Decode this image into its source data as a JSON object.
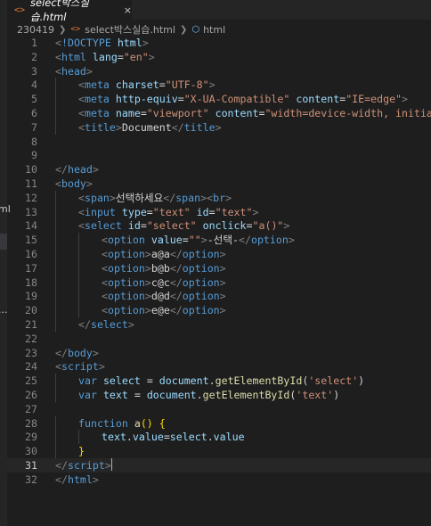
{
  "explorer": {
    "fragment_1": "ml",
    "fragment_2": "..."
  },
  "tab": {
    "icon": "html-file-icon",
    "label": "select박스실습.html",
    "close": "×"
  },
  "breadcrumb": {
    "folder": "230419",
    "file": "select박스실습.html",
    "symbol": "html"
  },
  "editor": {
    "current_line": 31,
    "lines": [
      {
        "n": "1",
        "indent": 0,
        "tokens": [
          [
            "br",
            "<"
          ],
          [
            "tag",
            "!DOCTYPE"
          ],
          [
            "txt",
            " "
          ],
          [
            "attr",
            "html"
          ],
          [
            "br",
            ">"
          ]
        ]
      },
      {
        "n": "2",
        "indent": 0,
        "tokens": [
          [
            "br",
            "<"
          ],
          [
            "tag",
            "html"
          ],
          [
            "txt",
            " "
          ],
          [
            "attr",
            "lang"
          ],
          [
            "pn",
            "="
          ],
          [
            "str",
            "\"en\""
          ],
          [
            "br",
            ">"
          ]
        ]
      },
      {
        "n": "3",
        "indent": 0,
        "tokens": [
          [
            "br",
            "<"
          ],
          [
            "tag",
            "head"
          ],
          [
            "br",
            ">"
          ]
        ]
      },
      {
        "n": "4",
        "indent": 1,
        "tokens": [
          [
            "br",
            "<"
          ],
          [
            "tag",
            "meta"
          ],
          [
            "txt",
            " "
          ],
          [
            "attr",
            "charset"
          ],
          [
            "pn",
            "="
          ],
          [
            "str",
            "\"UTF-8\""
          ],
          [
            "br",
            ">"
          ]
        ]
      },
      {
        "n": "5",
        "indent": 1,
        "tokens": [
          [
            "br",
            "<"
          ],
          [
            "tag",
            "meta"
          ],
          [
            "txt",
            " "
          ],
          [
            "attr",
            "http-equiv"
          ],
          [
            "pn",
            "="
          ],
          [
            "str",
            "\"X-UA-Compatible\""
          ],
          [
            "txt",
            " "
          ],
          [
            "attr",
            "content"
          ],
          [
            "pn",
            "="
          ],
          [
            "str",
            "\"IE=edge\""
          ],
          [
            "br",
            ">"
          ]
        ]
      },
      {
        "n": "6",
        "indent": 1,
        "tokens": [
          [
            "br",
            "<"
          ],
          [
            "tag",
            "meta"
          ],
          [
            "txt",
            " "
          ],
          [
            "attr",
            "name"
          ],
          [
            "pn",
            "="
          ],
          [
            "str",
            "\"viewport\""
          ],
          [
            "txt",
            " "
          ],
          [
            "attr",
            "content"
          ],
          [
            "pn",
            "="
          ],
          [
            "str",
            "\"width=device-width, initial-sca"
          ]
        ]
      },
      {
        "n": "7",
        "indent": 1,
        "tokens": [
          [
            "br",
            "<"
          ],
          [
            "tag",
            "title"
          ],
          [
            "br",
            ">"
          ],
          [
            "txt",
            "Document"
          ],
          [
            "br",
            "</"
          ],
          [
            "tag",
            "title"
          ],
          [
            "br",
            ">"
          ]
        ]
      },
      {
        "n": "8",
        "indent": 0,
        "tokens": []
      },
      {
        "n": "9",
        "indent": 0,
        "tokens": []
      },
      {
        "n": "10",
        "indent": 0,
        "tokens": [
          [
            "br",
            "</"
          ],
          [
            "tag",
            "head"
          ],
          [
            "br",
            ">"
          ]
        ]
      },
      {
        "n": "11",
        "indent": 0,
        "tokens": [
          [
            "br",
            "<"
          ],
          [
            "tag",
            "body"
          ],
          [
            "br",
            ">"
          ]
        ]
      },
      {
        "n": "12",
        "indent": 1,
        "tokens": [
          [
            "br",
            "<"
          ],
          [
            "tag",
            "span"
          ],
          [
            "br",
            ">"
          ],
          [
            "txt",
            "선택하세요"
          ],
          [
            "br",
            "</"
          ],
          [
            "tag",
            "span"
          ],
          [
            "br",
            "><"
          ],
          [
            "tag",
            "br"
          ],
          [
            "br",
            ">"
          ]
        ]
      },
      {
        "n": "13",
        "indent": 1,
        "tokens": [
          [
            "br",
            "<"
          ],
          [
            "tag",
            "input"
          ],
          [
            "txt",
            " "
          ],
          [
            "attr",
            "type"
          ],
          [
            "pn",
            "="
          ],
          [
            "str",
            "\"text\""
          ],
          [
            "txt",
            " "
          ],
          [
            "attr",
            "id"
          ],
          [
            "pn",
            "="
          ],
          [
            "str",
            "\"text\""
          ],
          [
            "br",
            ">"
          ]
        ]
      },
      {
        "n": "14",
        "indent": 1,
        "tokens": [
          [
            "br",
            "<"
          ],
          [
            "tag",
            "select"
          ],
          [
            "txt",
            " "
          ],
          [
            "attr",
            "id"
          ],
          [
            "pn",
            "="
          ],
          [
            "str",
            "\"select\""
          ],
          [
            "txt",
            " "
          ],
          [
            "attr",
            "onclick"
          ],
          [
            "pn",
            "="
          ],
          [
            "str",
            "\"a()\""
          ],
          [
            "br",
            ">"
          ]
        ]
      },
      {
        "n": "15",
        "indent": 2,
        "tokens": [
          [
            "br",
            "<"
          ],
          [
            "tag",
            "option"
          ],
          [
            "txt",
            " "
          ],
          [
            "attr",
            "value"
          ],
          [
            "pn",
            "="
          ],
          [
            "str",
            "\"\""
          ],
          [
            "br",
            ">"
          ],
          [
            "txt",
            "-선택-"
          ],
          [
            "br",
            "</"
          ],
          [
            "tag",
            "option"
          ],
          [
            "br",
            ">"
          ]
        ]
      },
      {
        "n": "16",
        "indent": 2,
        "tokens": [
          [
            "br",
            "<"
          ],
          [
            "tag",
            "option"
          ],
          [
            "br",
            ">"
          ],
          [
            "txt",
            "a@a"
          ],
          [
            "br",
            "</"
          ],
          [
            "tag",
            "option"
          ],
          [
            "br",
            ">"
          ]
        ]
      },
      {
        "n": "17",
        "indent": 2,
        "tokens": [
          [
            "br",
            "<"
          ],
          [
            "tag",
            "option"
          ],
          [
            "br",
            ">"
          ],
          [
            "txt",
            "b@b"
          ],
          [
            "br",
            "</"
          ],
          [
            "tag",
            "option"
          ],
          [
            "br",
            ">"
          ]
        ]
      },
      {
        "n": "18",
        "indent": 2,
        "tokens": [
          [
            "br",
            "<"
          ],
          [
            "tag",
            "option"
          ],
          [
            "br",
            ">"
          ],
          [
            "txt",
            "c@c"
          ],
          [
            "br",
            "</"
          ],
          [
            "tag",
            "option"
          ],
          [
            "br",
            ">"
          ]
        ]
      },
      {
        "n": "19",
        "indent": 2,
        "tokens": [
          [
            "br",
            "<"
          ],
          [
            "tag",
            "option"
          ],
          [
            "br",
            ">"
          ],
          [
            "txt",
            "d@d"
          ],
          [
            "br",
            "</"
          ],
          [
            "tag",
            "option"
          ],
          [
            "br",
            ">"
          ]
        ]
      },
      {
        "n": "20",
        "indent": 2,
        "tokens": [
          [
            "br",
            "<"
          ],
          [
            "tag",
            "option"
          ],
          [
            "br",
            ">"
          ],
          [
            "txt",
            "e@e"
          ],
          [
            "br",
            "</"
          ],
          [
            "tag",
            "option"
          ],
          [
            "br",
            ">"
          ]
        ]
      },
      {
        "n": "21",
        "indent": 1,
        "tokens": [
          [
            "br",
            "</"
          ],
          [
            "tag",
            "select"
          ],
          [
            "br",
            ">"
          ]
        ]
      },
      {
        "n": "22",
        "indent": 0,
        "tokens": []
      },
      {
        "n": "23",
        "indent": 0,
        "tokens": [
          [
            "br",
            "</"
          ],
          [
            "tag",
            "body"
          ],
          [
            "br",
            ">"
          ]
        ]
      },
      {
        "n": "24",
        "indent": 0,
        "tokens": [
          [
            "br",
            "<"
          ],
          [
            "tag",
            "script"
          ],
          [
            "br",
            ">"
          ]
        ]
      },
      {
        "n": "25",
        "indent": 1,
        "tokens": [
          [
            "kw",
            "var"
          ],
          [
            "txt",
            " "
          ],
          [
            "var",
            "select"
          ],
          [
            "txt",
            " "
          ],
          [
            "pn",
            "= "
          ],
          [
            "var",
            "document"
          ],
          [
            "pn",
            "."
          ],
          [
            "fn",
            "getElementById"
          ],
          [
            "pn",
            "("
          ],
          [
            "str",
            "'select'"
          ],
          [
            "pn",
            ")"
          ]
        ]
      },
      {
        "n": "26",
        "indent": 1,
        "tokens": [
          [
            "kw",
            "var"
          ],
          [
            "txt",
            " "
          ],
          [
            "var",
            "text"
          ],
          [
            "txt",
            " "
          ],
          [
            "pn",
            "= "
          ],
          [
            "var",
            "document"
          ],
          [
            "pn",
            "."
          ],
          [
            "fn",
            "getElementById"
          ],
          [
            "pn",
            "("
          ],
          [
            "str",
            "'text'"
          ],
          [
            "pn",
            ")"
          ]
        ]
      },
      {
        "n": "27",
        "indent": 0,
        "tokens": []
      },
      {
        "n": "28",
        "indent": 1,
        "tokens": [
          [
            "kw",
            "function"
          ],
          [
            "txt",
            " "
          ],
          [
            "fn",
            "a"
          ],
          [
            "brace",
            "()"
          ],
          [
            "txt",
            " "
          ],
          [
            "brace",
            "{"
          ]
        ]
      },
      {
        "n": "29",
        "indent": 2,
        "tokens": [
          [
            "var",
            "text"
          ],
          [
            "pn",
            "."
          ],
          [
            "var",
            "value"
          ],
          [
            "pn",
            "="
          ],
          [
            "var",
            "select"
          ],
          [
            "pn",
            "."
          ],
          [
            "var",
            "value"
          ]
        ]
      },
      {
        "n": "30",
        "indent": 1,
        "tokens": [
          [
            "brace",
            "}"
          ]
        ]
      },
      {
        "n": "31",
        "indent": 0,
        "tokens": [
          [
            "br",
            "</"
          ],
          [
            "tag",
            "script"
          ],
          [
            "br",
            ">"
          ]
        ]
      },
      {
        "n": "32",
        "indent": 0,
        "tokens": [
          [
            "br",
            "</"
          ],
          [
            "tag",
            "html"
          ],
          [
            "br",
            ">"
          ]
        ]
      }
    ]
  }
}
